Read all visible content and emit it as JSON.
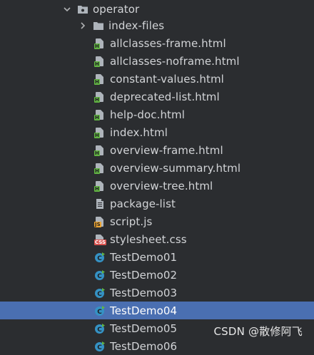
{
  "tree": {
    "items": [
      {
        "label": "operator",
        "icon": "package-folder-icon",
        "kind": "folder-open"
      },
      {
        "label": "index-files",
        "icon": "folder-icon",
        "kind": "folder-closed"
      },
      {
        "label": "allclasses-frame.html",
        "icon": "html-file-icon",
        "kind": "html"
      },
      {
        "label": "allclasses-noframe.html",
        "icon": "html-file-icon",
        "kind": "html"
      },
      {
        "label": "constant-values.html",
        "icon": "html-file-icon",
        "kind": "html"
      },
      {
        "label": "deprecated-list.html",
        "icon": "html-file-icon",
        "kind": "html"
      },
      {
        "label": "help-doc.html",
        "icon": "html-file-icon",
        "kind": "html"
      },
      {
        "label": "index.html",
        "icon": "html-file-icon",
        "kind": "html"
      },
      {
        "label": "overview-frame.html",
        "icon": "html-file-icon",
        "kind": "html"
      },
      {
        "label": "overview-summary.html",
        "icon": "html-file-icon",
        "kind": "html"
      },
      {
        "label": "overview-tree.html",
        "icon": "html-file-icon",
        "kind": "html"
      },
      {
        "label": "package-list",
        "icon": "text-file-icon",
        "kind": "text"
      },
      {
        "label": "script.js",
        "icon": "js-file-icon",
        "kind": "js"
      },
      {
        "label": "stylesheet.css",
        "icon": "css-file-icon",
        "kind": "css"
      },
      {
        "label": "TestDemo01",
        "icon": "java-class-icon",
        "kind": "class"
      },
      {
        "label": "TestDemo02",
        "icon": "java-class-icon",
        "kind": "class"
      },
      {
        "label": "TestDemo03",
        "icon": "java-class-icon",
        "kind": "class"
      },
      {
        "label": "TestDemo04",
        "icon": "java-class-icon",
        "kind": "class",
        "selected": true
      },
      {
        "label": "TestDemo05",
        "icon": "java-class-icon",
        "kind": "class"
      },
      {
        "label": "TestDemo06",
        "icon": "java-class-icon",
        "kind": "class"
      }
    ]
  },
  "watermark": "CSDN @散修阿飞",
  "colors": {
    "background": "#2b2d30",
    "selection": "#4a6fb1",
    "html_badge": "#62b543",
    "js_badge": "#f0a732",
    "css_badge": "#d9534f",
    "class_icon": "#3592c4",
    "class_arrow": "#62b543"
  }
}
